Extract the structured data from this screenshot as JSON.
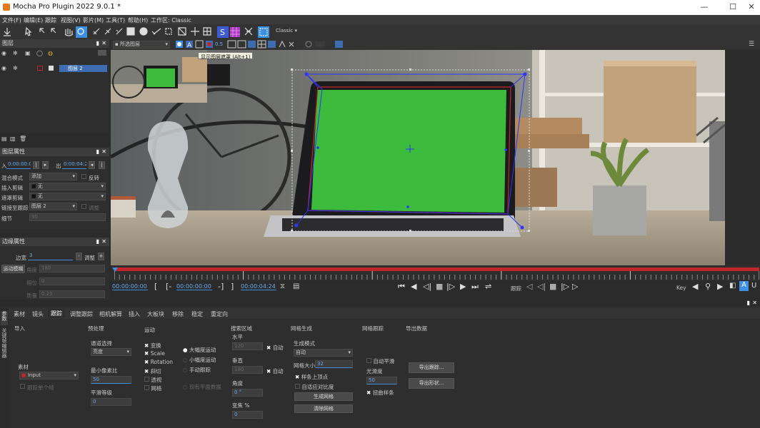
{
  "window": {
    "title": "Mocha Pro Plugin 2022 9.0.1 *",
    "min": "—",
    "max": "☐",
    "close": "✕"
  },
  "menu": [
    "文件(F)",
    "编辑(E)",
    "跟踪",
    "视图(V)",
    "影片(M)",
    "工具(T)",
    "帮助(H)",
    "工作区: Classic"
  ],
  "toolbar": {
    "workspace": "Classic"
  },
  "view_toolbar": {
    "layer_select": "所选图层",
    "zoom_value": "0.5",
    "tooltip": "显示图层遮罩 (Alt+1)"
  },
  "layers_panel": {
    "title": "图层",
    "layers": [
      {
        "name": ""
      },
      {
        "name": "图层 2"
      }
    ]
  },
  "layer_props": {
    "title": "图层属性",
    "in_label": "入",
    "in_value": "0:00:00:00",
    "out_label": "出",
    "out_value": "0:00:04:24",
    "blend_label": "混合模式",
    "blend_value": "添加",
    "invert_label": "反转",
    "insert_clip_label": "插入剪辑",
    "insert_clip_value": "无",
    "matte_clip_label": "遮罩剪辑",
    "matte_clip_value": "无",
    "link_track_label": "链接至跟踪",
    "link_track_value": "图层 2",
    "adjust_label": "调整",
    "detail_label": "细节",
    "detail_value": "90"
  },
  "edge_props": {
    "title": "边缘属性",
    "width_label": "边宽",
    "width_value": "3",
    "adjust_label": "调整",
    "motion_blur_btn": "运动模糊",
    "angle_label": "角度",
    "angle_value": "180",
    "phase_label": "相位",
    "phase_value": "0",
    "quality_label": "质量",
    "quality_value": "0.25"
  },
  "timeline": {
    "current_time": "00:00:00:00",
    "in_time": "00:00:00:00",
    "out_time": "00:00:04:24",
    "track_label": "跟踪",
    "key_label": "Key"
  },
  "bottom_tabs": [
    "素材",
    "镜头",
    "跟踪",
    "调整跟踪",
    "相机解算",
    "插入",
    "大板块",
    "移除",
    "稳定",
    "重定向"
  ],
  "side_tabs": [
    "参数",
    "关键帧编辑器"
  ],
  "track_tab": {
    "import": {
      "title": "导入",
      "clip_label": "素材",
      "clip_value": "Input",
      "track_frames": "跟踪单个帧"
    },
    "preprocess": {
      "title": "预处理",
      "channel_label": "通道选择",
      "channel_value": "亮度",
      "min_pixels_label": "最小像素比",
      "min_pixels_value": "50",
      "smooth_label": "平滑等级",
      "smooth_value": "0"
    },
    "motion": {
      "title": "运动",
      "checks": [
        "变换",
        "Scale",
        "Rotation",
        "斜切",
        "透视",
        "网格"
      ],
      "radios": [
        "大幅度运动",
        "小幅度运动",
        "手动跟踪"
      ],
      "existing_planar": "现有平面数据"
    },
    "search_area": {
      "title": "搜索区域",
      "h_label": "水平",
      "h_value": "120",
      "auto": "自动",
      "v_label": "垂直",
      "v_value": "180",
      "angle_label": "角度",
      "angle_value": "0 °",
      "zoom_label": "变焦 %",
      "zoom_value": "0"
    },
    "mesh_gen": {
      "title": "网格生成",
      "mode_label": "生成模式",
      "mode_value": "自动",
      "size_label": "网格大小",
      "size_value": "32",
      "snap": "样条上顶点",
      "adaptive": "自适应对比度",
      "generate_btn": "生成网格",
      "clear_btn": "清除网格"
    },
    "mesh_track": {
      "title": "网格跟踪",
      "auto_smooth": "自动平滑",
      "smoothness_label": "光滑度",
      "smoothness_value": "50",
      "warp": "扭曲样条"
    },
    "export": {
      "title": "导出数据",
      "export_track_btn": "导出跟踪...",
      "export_shape_btn": "导出形状..."
    }
  },
  "colors": {
    "accent": "#3d8fe0",
    "red": "#c0262b",
    "screen_green": "#3dbb3d",
    "spline_blue": "#2b35ff"
  }
}
